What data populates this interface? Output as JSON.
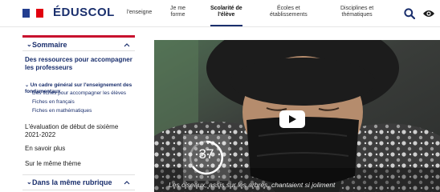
{
  "header": {
    "brand": "ÉDUSCOL",
    "nav": [
      {
        "label": "l'enseigne"
      },
      {
        "label": "Je me\nforme"
      },
      {
        "label": "Scolarité de\nl'élève"
      },
      {
        "label": "Écoles et\nétablissements"
      },
      {
        "label": "Disciplines et\nthématiques"
      }
    ],
    "icons": [
      "search-icon",
      "eye-icon"
    ],
    "flag_colors": [
      "#233e8f",
      "#ffffff",
      "#e1000f"
    ]
  },
  "sidebar": {
    "sommaire_title": "Sommaire",
    "toggle_symbol": "⌄",
    "main_link": "Des ressources pour accompagner\nles professeurs",
    "sub_active": "Un cadre général sur l'enseignement des\nfondamentaux",
    "sub_items": [
      "Des fiches pour accompagner les élèves",
      "Fiches en français",
      "Fiches en mathématiques"
    ],
    "evaluation_link": "L'évaluation de début de sixième\n2021-2022",
    "more_link": "En savoir plus",
    "theme_link": "Sur le même thème",
    "rubrique_title": "Dans la même rubrique"
  },
  "video": {
    "counter": "37",
    "caption": "Les oiseaux, assis sur les arbres, chantaient si joliment",
    "accent_color": "#1a2f6d"
  }
}
